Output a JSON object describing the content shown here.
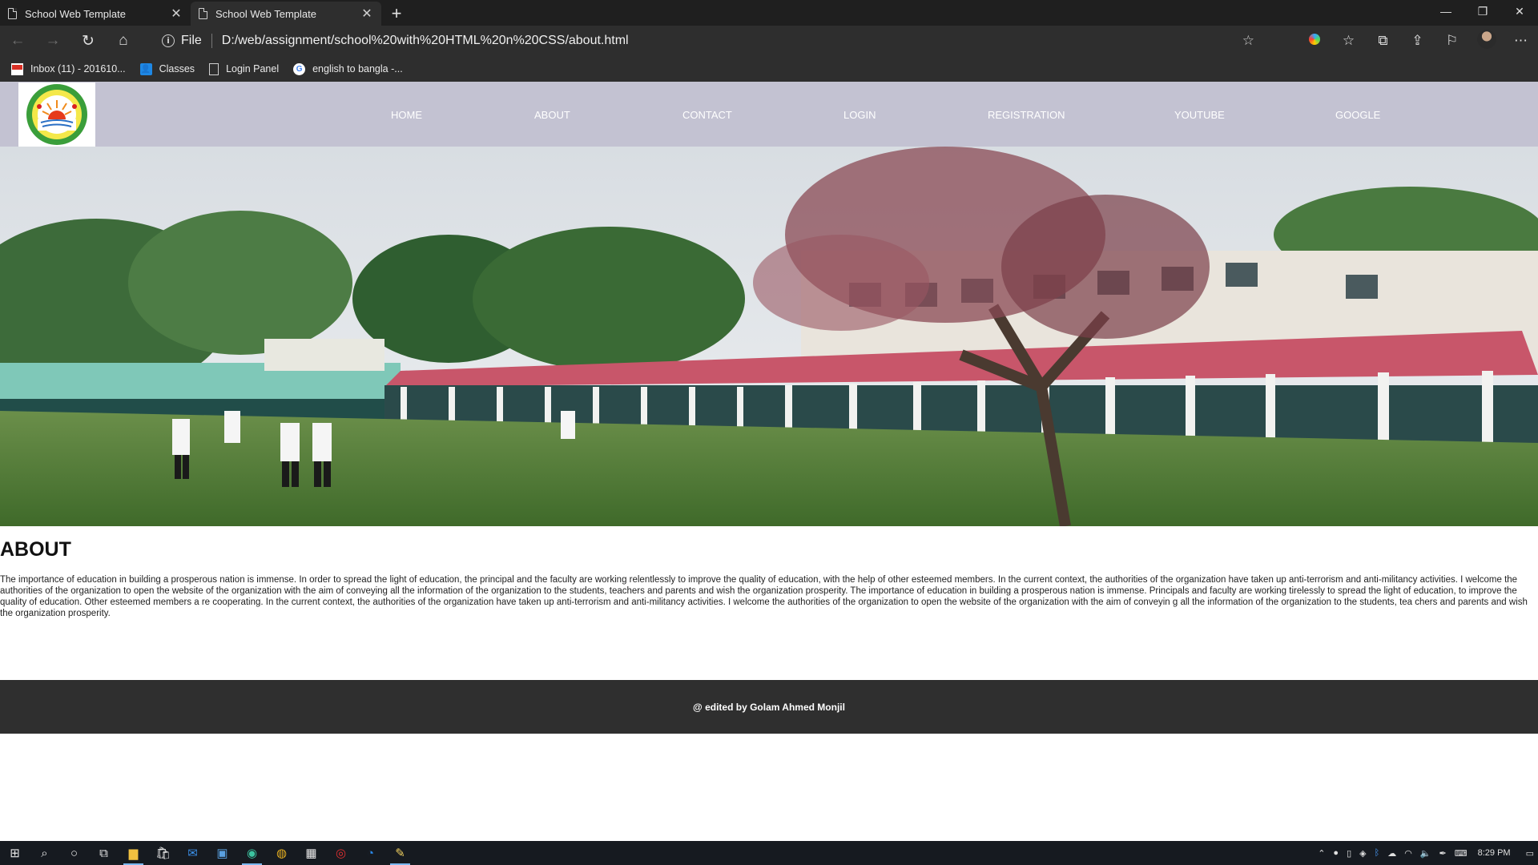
{
  "browser": {
    "tabs": [
      {
        "title": "School Web Template"
      },
      {
        "title": "School Web Template"
      }
    ],
    "new_tab_icon": "plus-icon",
    "address": {
      "scheme": "File",
      "url": "D:/web/assignment/school%20with%20HTML%20n%20CSS/about.html"
    },
    "bookmarks": [
      {
        "label": "Inbox (11) - 201610...",
        "icon": "gmail-icon"
      },
      {
        "label": "Classes",
        "icon": "classes-icon"
      },
      {
        "label": "Login Panel",
        "icon": "page-icon"
      },
      {
        "label": "english to bangla -...",
        "icon": "google-icon"
      }
    ]
  },
  "site": {
    "nav": [
      {
        "label": "HOME"
      },
      {
        "label": "ABOUT"
      },
      {
        "label": "CONTACT"
      },
      {
        "label": "LOGIN"
      },
      {
        "label": "REGISTRATION"
      },
      {
        "label": "YOUTUBE"
      },
      {
        "label": "GOOGLE"
      }
    ],
    "about": {
      "title": "ABOUT",
      "text": "The importance of education in building a prosperous nation is immense. In order to spread the light of education, the principal and the faculty are working relentlessly to improve the quality of education, with the help of other esteemed members. In the current context, the authorities of the organization have taken up anti-terrorism and anti-militancy activities. I welcome the authorities of the organization to open the website of the organization with the aim of conveying all the information of the organization to the students, teachers and parents and wish the organization prosperity. The importance of education in building a prosperous nation is immense. Principals and faculty are working tirelessly to spread the light of education, to improve the quality of education. Other esteemed members a re cooperating. In the current context, the authorities of the organization have taken up anti-terrorism and anti-militancy activities. I welcome the authorities of the organization to open the website of the organization with the aim of conveyin g all the information of the organization to the students, tea chers and parents and wish the organization prosperity."
    },
    "footer": "@ edited by Golam Ahmed Monjil"
  },
  "taskbar": {
    "clock": "8:29 PM"
  },
  "colors": {
    "header_bg": "#c3c2d2",
    "footer_bg": "#2f2f2f",
    "chrome_bg": "#2e2e2e"
  }
}
